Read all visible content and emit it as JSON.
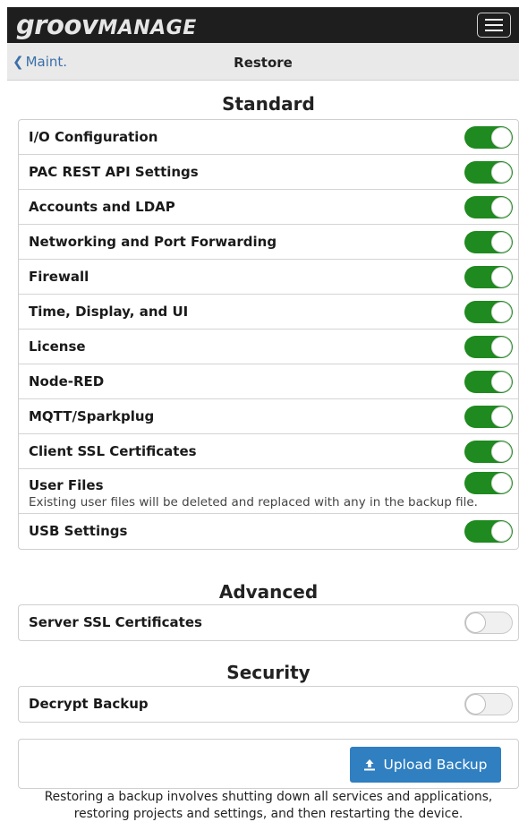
{
  "header": {
    "logo_primary": "groov",
    "logo_secondary": "MANAGE",
    "menu_icon": "hamburger-icon"
  },
  "navbar": {
    "back_label": "Maint.",
    "title": "Restore"
  },
  "sections": {
    "standard": {
      "title": "Standard",
      "items": [
        {
          "label": "I/O Configuration",
          "enabled": true
        },
        {
          "label": "PAC REST API Settings",
          "enabled": true
        },
        {
          "label": "Accounts and LDAP",
          "enabled": true
        },
        {
          "label": "Networking and Port Forwarding",
          "enabled": true
        },
        {
          "label": "Firewall",
          "enabled": true
        },
        {
          "label": "Time, Display, and UI",
          "enabled": true
        },
        {
          "label": "License",
          "enabled": true
        },
        {
          "label": "Node-RED",
          "enabled": true
        },
        {
          "label": "MQTT/Sparkplug",
          "enabled": true
        },
        {
          "label": "Client SSL Certificates",
          "enabled": true
        },
        {
          "label": "User Files",
          "enabled": true,
          "description": "Existing user files will be deleted and replaced with any in the backup file."
        },
        {
          "label": "USB Settings",
          "enabled": true
        }
      ]
    },
    "advanced": {
      "title": "Advanced",
      "items": [
        {
          "label": "Server SSL Certificates",
          "enabled": false
        }
      ]
    },
    "security": {
      "title": "Security",
      "items": [
        {
          "label": "Decrypt Backup",
          "enabled": false
        }
      ]
    }
  },
  "upload": {
    "button_label": "Upload Backup",
    "icon": "upload-icon"
  },
  "footnote": {
    "line1": "Restoring a backup involves shutting down all services and applications,",
    "line2": "restoring projects and settings, and then restarting the device."
  },
  "colors": {
    "toggle_on": "#1f8a1f",
    "upload_button": "#2f7fc1",
    "link": "#3b6fa9"
  }
}
